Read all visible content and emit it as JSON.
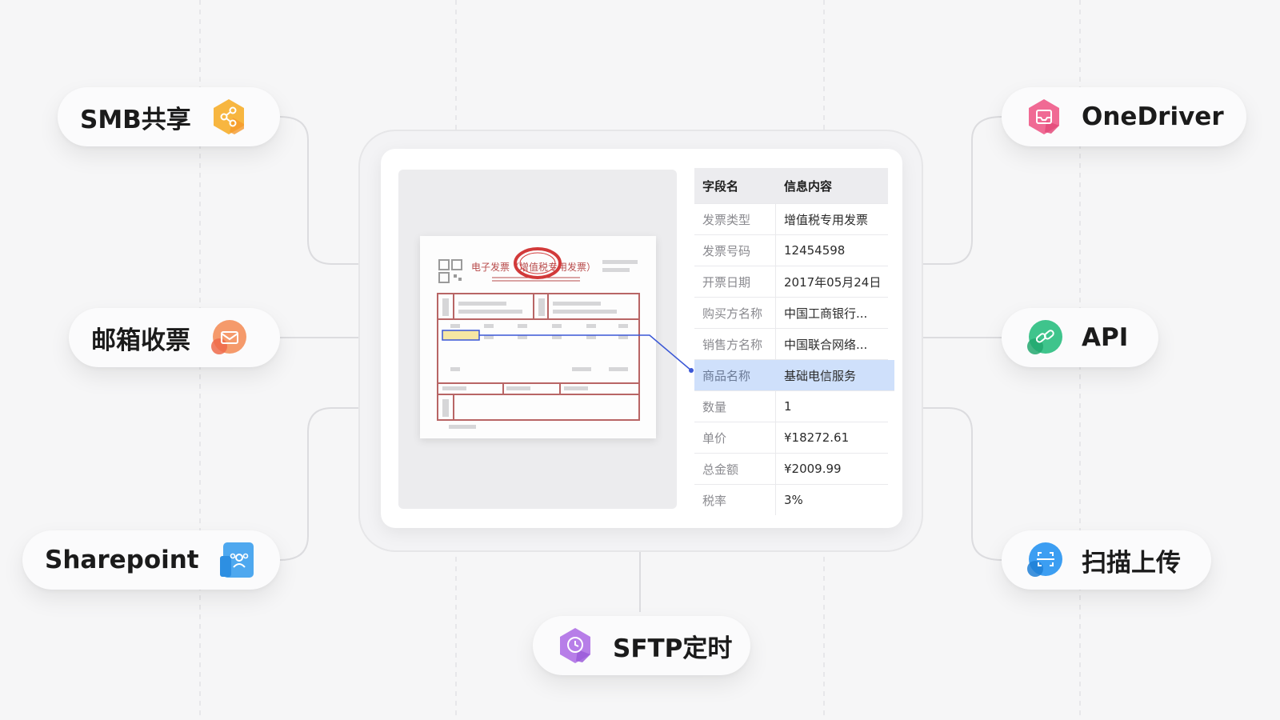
{
  "sources": {
    "smb": {
      "label": "SMB共享",
      "icon": "share-icon",
      "color": "#f7b640"
    },
    "email": {
      "label": "邮箱收票",
      "icon": "envelope-icon",
      "color": "#f59a6b"
    },
    "sharepoint": {
      "label": "Sharepoint",
      "icon": "users-icon",
      "color": "#4ea8ef"
    },
    "onedriver": {
      "label": "OneDriver",
      "icon": "inbox-icon",
      "color": "#f06a94"
    },
    "api": {
      "label": "API",
      "icon": "link-icon",
      "color": "#3fc48c"
    },
    "scan": {
      "label": "扫描上传",
      "icon": "scan-icon",
      "color": "#3c9ef2"
    },
    "sftp": {
      "label": "SFTP定时",
      "icon": "clock-icon",
      "color": "#b77ee8"
    }
  },
  "invoice": {
    "title": "电子发票（增值税专用发票）",
    "stamp_color": "#d23a3a"
  },
  "table": {
    "header": {
      "field": "字段名",
      "value": "信息内容"
    },
    "rows": [
      {
        "field": "发票类型",
        "value": "增值税专用发票"
      },
      {
        "field": "发票号码",
        "value": "12454598"
      },
      {
        "field": "开票日期",
        "value": "2017年05月24日"
      },
      {
        "field": "购买方名称",
        "value": "中国工商银行..."
      },
      {
        "field": "销售方名称",
        "value": "中国联合网络..."
      },
      {
        "field": "商品名称",
        "value": "基础电信服务",
        "selected": true
      },
      {
        "field": "数量",
        "value": "1"
      },
      {
        "field": "单价",
        "value": "¥18272.61"
      },
      {
        "field": "总金额",
        "value": "¥2009.99"
      },
      {
        "field": "税率",
        "value": "3%"
      }
    ]
  }
}
